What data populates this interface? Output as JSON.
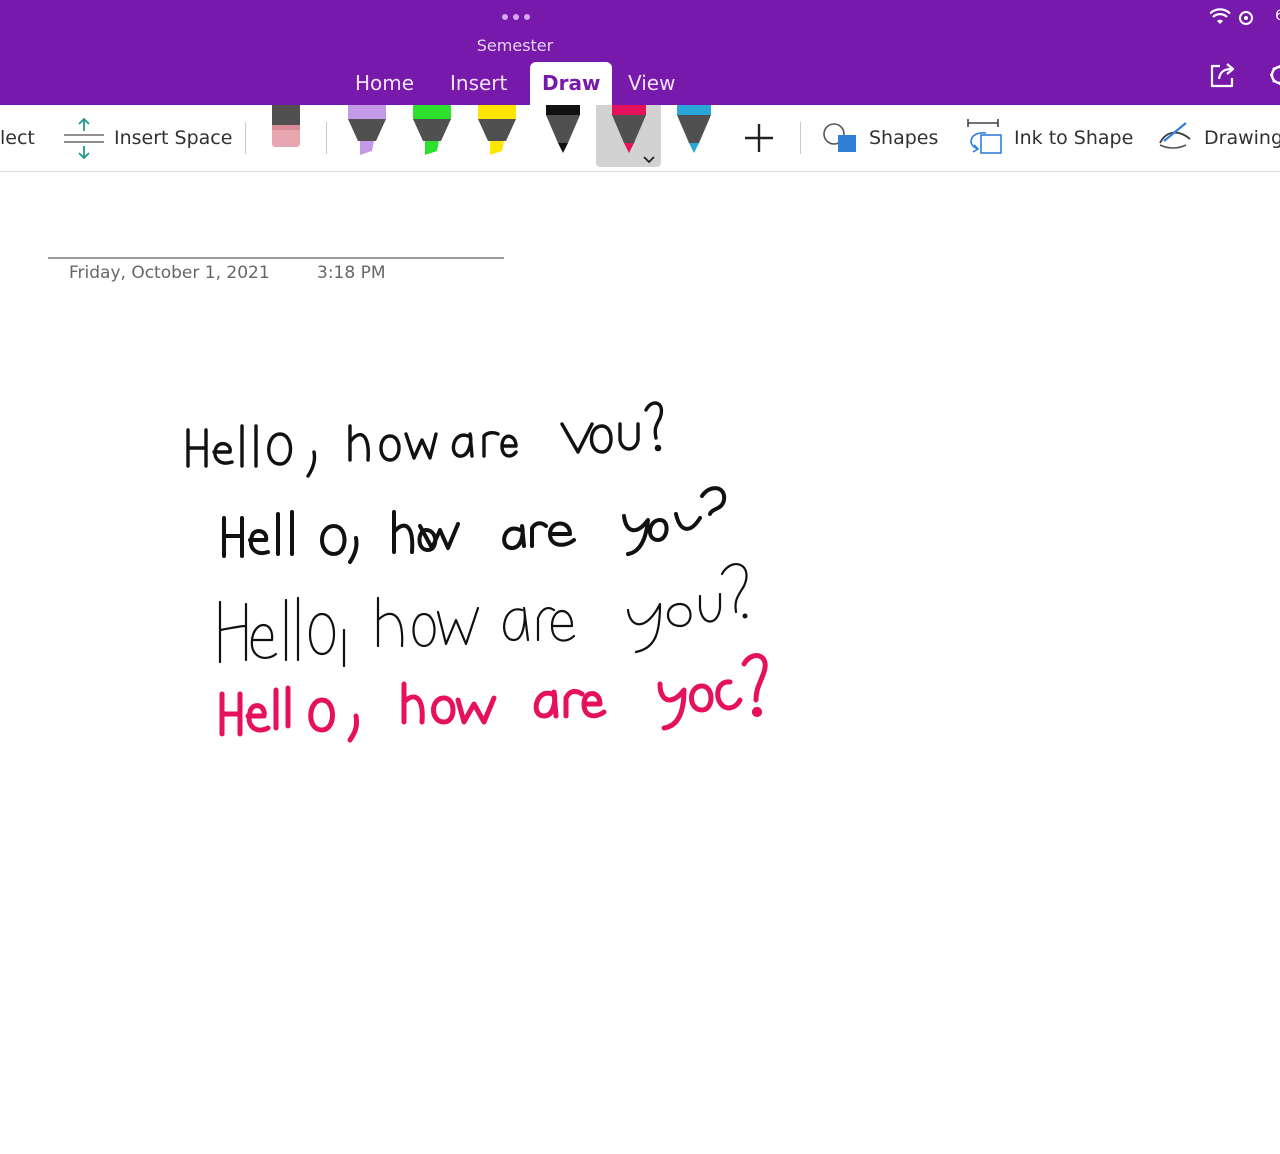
{
  "header": {
    "title": "Semester",
    "tabs": [
      {
        "label": "Home",
        "active": false
      },
      {
        "label": "Insert",
        "active": false
      },
      {
        "label": "Draw",
        "active": true
      },
      {
        "label": "View",
        "active": false
      }
    ],
    "battery_partial": "6"
  },
  "toolbar": {
    "lasso_label_partial": "lect",
    "insert_space_label": "Insert Space",
    "shapes_label": "Shapes",
    "ink_to_shape_label": "Ink to Shape",
    "drawing_label_partial": "Drawing",
    "pens": [
      {
        "kind": "eraser",
        "color": "#e8a6b0"
      },
      {
        "kind": "highlighter",
        "color": "#c39ae8"
      },
      {
        "kind": "highlighter",
        "color": "#2ee02e"
      },
      {
        "kind": "highlighter",
        "color": "#ffe600"
      },
      {
        "kind": "pen",
        "color": "#111111"
      },
      {
        "kind": "pen",
        "color": "#e6115c",
        "selected": true
      },
      {
        "kind": "pen",
        "color": "#2aa6d8"
      }
    ]
  },
  "page": {
    "date": "Friday, October 1, 2021",
    "time": "3:18 PM",
    "handwriting": [
      {
        "text": "Hello, how are you?",
        "color": "#111111"
      },
      {
        "text": "Hell o, how are you?",
        "color": "#111111"
      },
      {
        "text": "Hello, how are you?",
        "color": "#111111"
      },
      {
        "text": "Hello, how are you?",
        "color": "#e6115c"
      }
    ]
  },
  "colors": {
    "accent": "#7719aa",
    "ink_pink": "#e6115c"
  }
}
